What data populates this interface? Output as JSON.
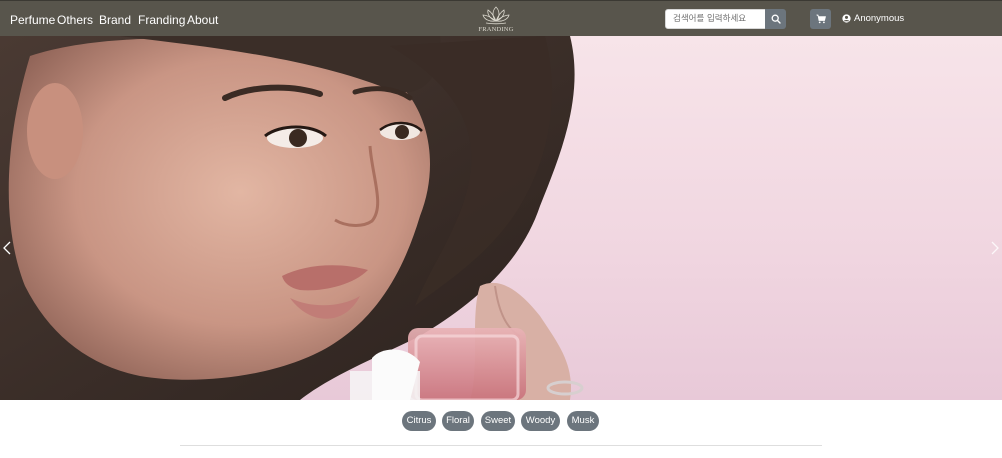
{
  "navbar": {
    "links": [
      "Perfume",
      "Others",
      "Brand",
      "Franding",
      "About"
    ],
    "brand_text": "FRANDING",
    "search": {
      "placeholder": "검색어를 입력하세요",
      "button_icon": "search-icon"
    },
    "cart_icon": "cart-icon",
    "user": {
      "icon": "user-circle-icon",
      "label": "Anonymous"
    }
  },
  "hero": {
    "prev_icon": "chevron-left-icon",
    "next_icon": "chevron-right-icon"
  },
  "tags": [
    "Citrus",
    "Floral",
    "Sweet",
    "Woody",
    "Musk"
  ],
  "colors": {
    "navbar_bg": "#58554c",
    "button_gray": "#6c757d",
    "hero_bg": "#f3dde5"
  }
}
